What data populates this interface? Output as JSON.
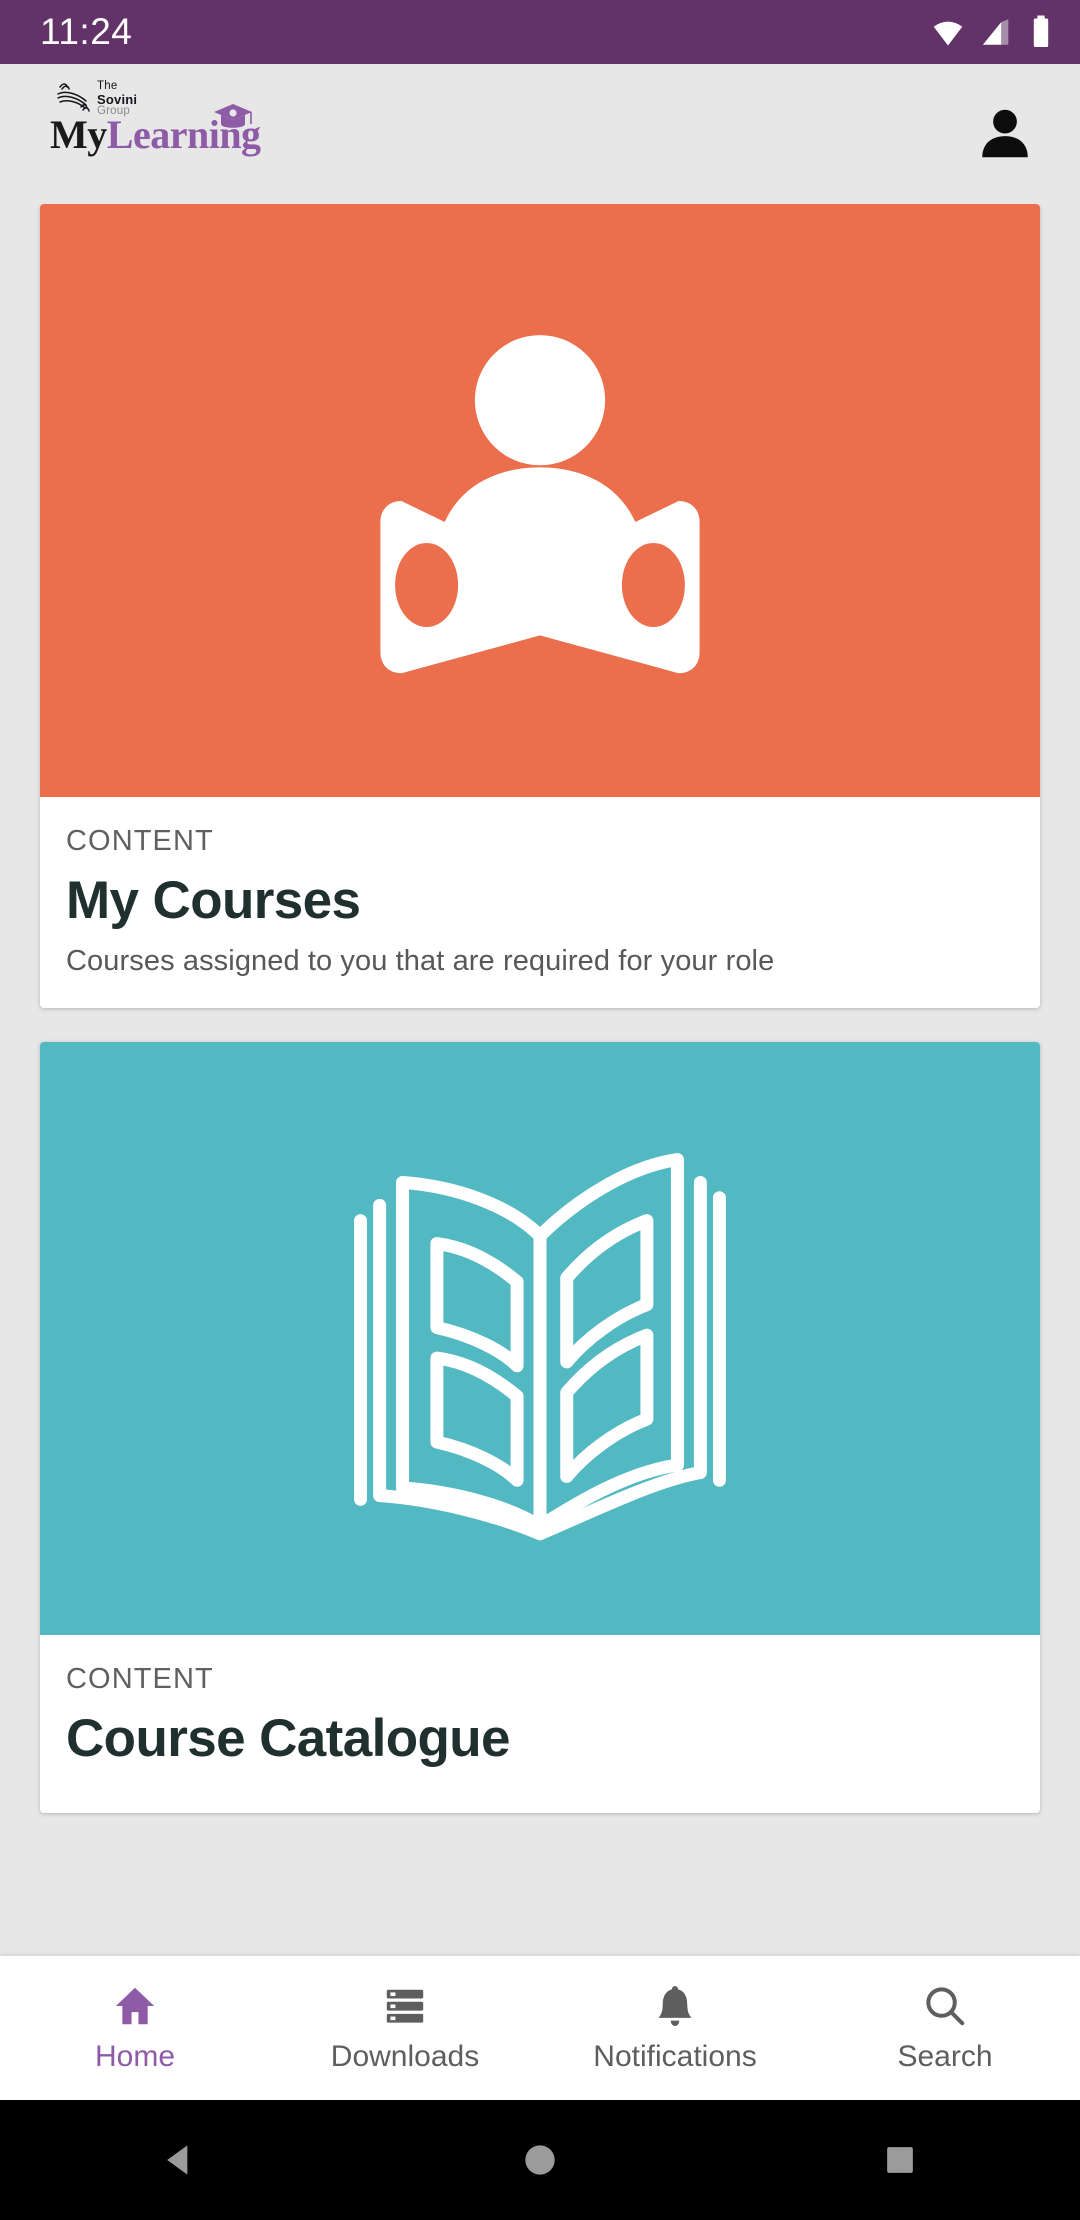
{
  "status_bar": {
    "time": "11:24",
    "background": "#633268",
    "icons": [
      "wifi-icon",
      "cellular-signal-icon",
      "battery-icon"
    ]
  },
  "header": {
    "logo_top_line": "The",
    "logo_mid_line": "Sovini",
    "logo_bottom_line": "Group",
    "wordmark_part1": "My",
    "wordmark_part2": "Learning",
    "brand_purple": "#8e5ba6",
    "account_icon": "person-avatar-icon"
  },
  "cards": [
    {
      "kicker": "CONTENT",
      "title": "My Courses",
      "description": "Courses assigned to you that are required for your role",
      "hero_color": "#ec6f4d",
      "hero_icon": "person-reading-book-icon"
    },
    {
      "kicker": "CONTENT",
      "title": "Course Catalogue",
      "description": "",
      "hero_color": "#52b8c2",
      "hero_icon": "open-book-icon"
    }
  ],
  "bottom_nav": {
    "active_color": "#8e5ba6",
    "inactive_color": "#5e5e5e",
    "items": [
      {
        "label": "Home",
        "icon": "home-icon",
        "active": true
      },
      {
        "label": "Downloads",
        "icon": "downloads-list-icon",
        "active": false
      },
      {
        "label": "Notifications",
        "icon": "bell-icon",
        "active": false
      },
      {
        "label": "Search",
        "icon": "magnifier-icon",
        "active": false
      }
    ]
  },
  "system_nav": {
    "back": "back-triangle-icon",
    "home": "home-circle-icon",
    "recents": "recents-square-icon"
  }
}
